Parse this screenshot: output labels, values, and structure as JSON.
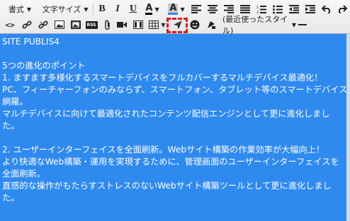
{
  "toolbar": {
    "row1": {
      "format_label": "書式",
      "font_size_label": "文字サイズ",
      "bold_label": "B",
      "italic_label": "I",
      "underline_label": "U",
      "text_color_label": "A",
      "bg_color_label": "A"
    },
    "row2": {
      "source_label": "<>",
      "rss_label": "RSS",
      "style_label": "(最近使ったスタイル)"
    },
    "colors": {
      "accent": "#2f8af0",
      "highlight": "#e0191d",
      "text_color_bar": "#000000",
      "bg_color_bar": "#2f8af0"
    }
  },
  "editor": {
    "lines": [
      "SITE PUBLIS4",
      "",
      "5つの進化のポイント",
      "1. ますます多様化するスマートデバイスをフルカバーするマルチデバイス最適化！",
      "PC、フィーチャーフォンのみならず、スマートフォン、タブレット等のスマートデバイスを",
      "網羅。",
      "マルチデバイスに向けて最適化されたコンテンツ配信エンジンとして更に進化しまし",
      "た。",
      "",
      "2. ユーザーインターフェイスを全面刷新。Webサイト構築の作業効率が大幅向上！",
      "より快適なWeb構築・運用を実現するために、管理画面のユーザーインターフェイスを",
      "全面刷新。",
      "直感的な操作がもたらすストレスのないWebサイト構築ツールとして更に進化しまし",
      "た。"
    ]
  }
}
